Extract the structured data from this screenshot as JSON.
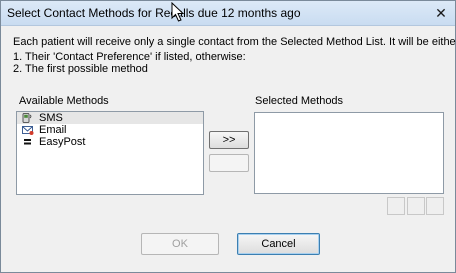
{
  "window": {
    "title": "Select Contact Methods for Recalls due 12 months ago",
    "close_symbol": "✕"
  },
  "description": {
    "line1": "Each patient will receive only a single contact from the Selected Method List. It will be either;",
    "line2": "1. Their 'Contact Preference' if listed, otherwise:",
    "line3": "2. The first possible method"
  },
  "available": {
    "label": "Available Methods",
    "items": [
      {
        "label": "SMS",
        "icon": "sms-phone-icon"
      },
      {
        "label": "Email",
        "icon": "email-icon"
      },
      {
        "label": "EasyPost",
        "icon": "easypost-icon"
      }
    ]
  },
  "selected": {
    "label": "Selected Methods",
    "items": []
  },
  "buttons": {
    "add": ">>",
    "remove": "",
    "ok": "OK",
    "cancel": "Cancel"
  },
  "colors": {
    "titlebar": "#c9dcf1",
    "dialog_bg": "#f0f0f0",
    "default_button_border": "#3c7fb1"
  }
}
